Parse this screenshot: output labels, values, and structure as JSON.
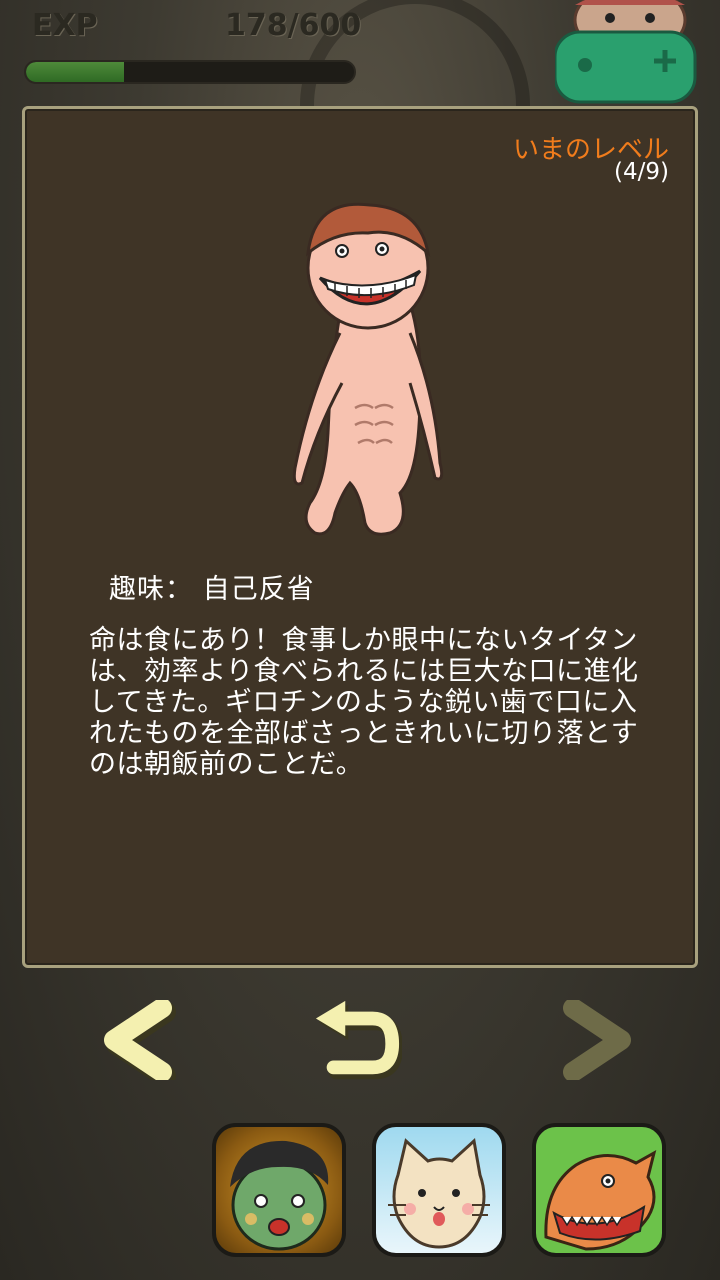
{
  "hud": {
    "exp_label": "EXP",
    "exp_value": "178/600",
    "exp_progress": 0.3
  },
  "panel": {
    "level_label": "いまのレベル",
    "level_count": "(4/9)",
    "hobby": "趣味： 自己反省",
    "description": "命は食にあり！食事しか眼中にないタイタンは、効率より食べられるには巨大な口に進化してきた。ギロチンのような鋭い歯で口に入れたものを全部ばさっときれいに切り落とすのは朝飯前のことだ。"
  },
  "nav": {
    "prev_icon": "chevron-left-icon",
    "back_icon": "return-arrow-icon",
    "next_icon": "chevron-right-icon"
  },
  "promo_apps": [
    {
      "icon": "zombie-app-icon"
    },
    {
      "icon": "cat-app-icon"
    },
    {
      "icon": "dinosaur-app-icon"
    }
  ],
  "colors": {
    "panel_bg": "#3f3426",
    "panel_border": "#a8a17e",
    "level_label": "#f07c1c",
    "nav_active": "#f4f0b0",
    "nav_disabled": "#6e6b48",
    "exp_fill": "#4e8a3a"
  }
}
